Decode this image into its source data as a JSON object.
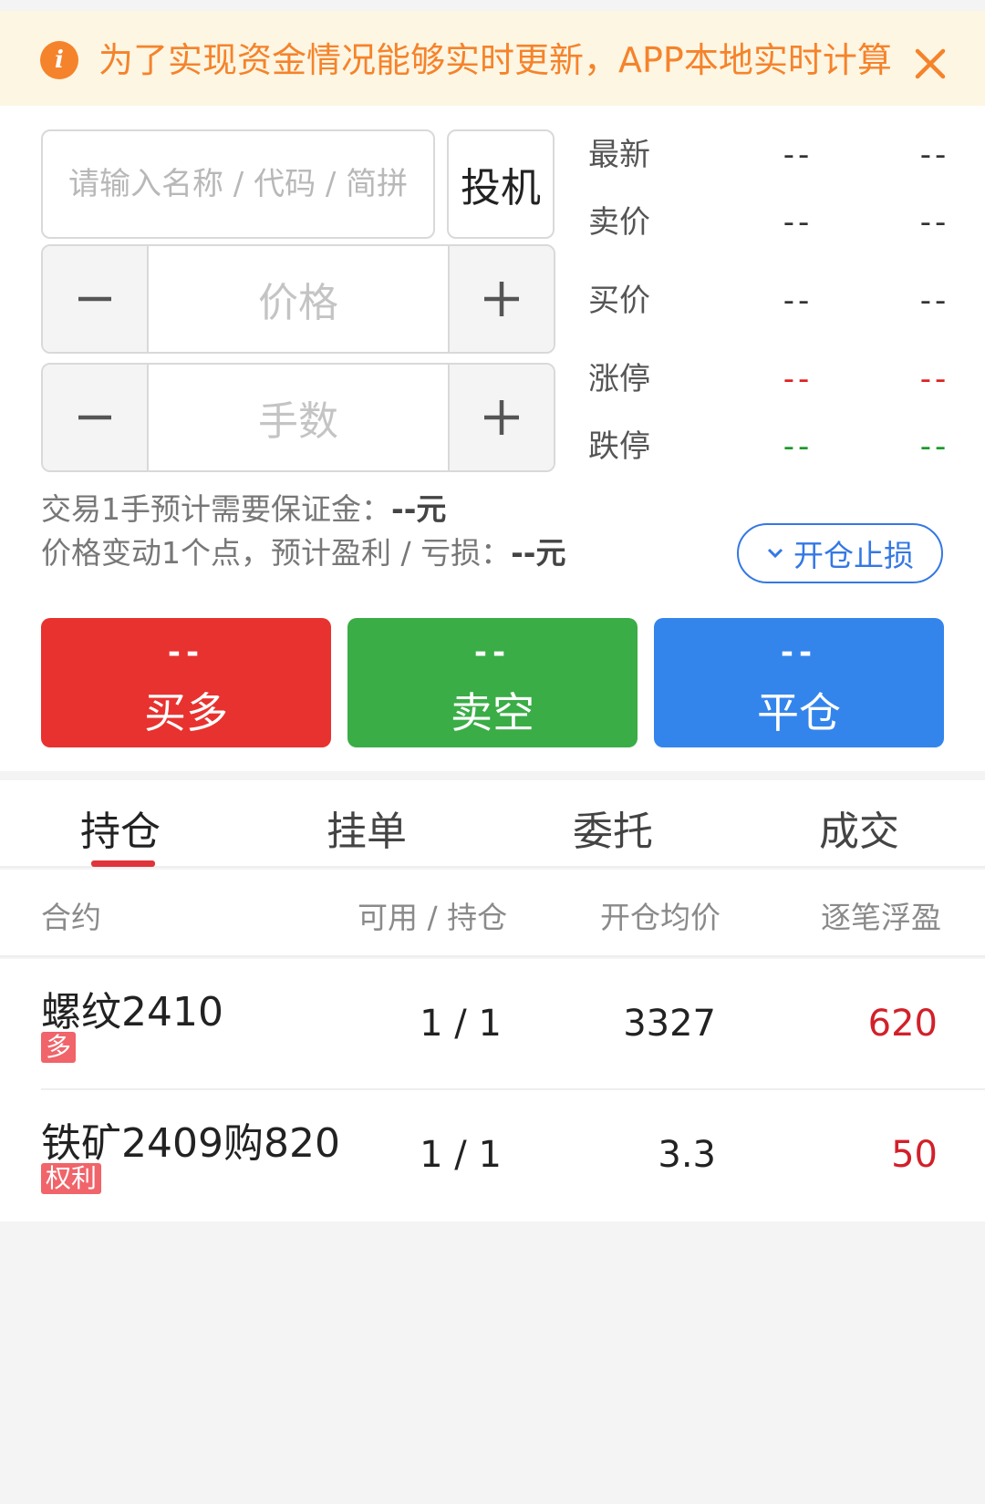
{
  "notice": {
    "text": "为了实现资金情况能够实时更新，APP本地实时计算",
    "icon": "info-icon",
    "close_icon": "close-icon",
    "accent_color": "#f5832b"
  },
  "order_form": {
    "search_placeholder": "请输入名称 / 代码 / 简拼",
    "search_value": "",
    "mode_label": "投机",
    "price_placeholder": "价格",
    "lots_placeholder": "手数"
  },
  "quotes": [
    {
      "label": "最新",
      "v1": "--",
      "v2": "--",
      "color": "default"
    },
    {
      "label": "卖价",
      "v1": "--",
      "v2": "--",
      "color": "default"
    },
    {
      "label": "买价",
      "v1": "--",
      "v2": "--",
      "color": "default"
    },
    {
      "label": "涨停",
      "v1": "--",
      "v2": "--",
      "color": "red"
    },
    {
      "label": "跌停",
      "v1": "--",
      "v2": "--",
      "color": "green"
    }
  ],
  "info": {
    "margin_prefix": "交易1手预计需要保证金：",
    "margin_value": "--元",
    "pnl_prefix": "价格变动1个点，预计盈利 / 亏损：",
    "pnl_value": "--元"
  },
  "stoploss_button": {
    "label": "开仓止损",
    "icon": "chevron-down-icon"
  },
  "actions": {
    "buy": {
      "price": "--",
      "label": "买多"
    },
    "sell": {
      "price": "--",
      "label": "卖空"
    },
    "close": {
      "price": "--",
      "label": "平仓"
    }
  },
  "tabs": [
    {
      "label": "持仓",
      "active": true
    },
    {
      "label": "挂单",
      "active": false
    },
    {
      "label": "委托",
      "active": false
    },
    {
      "label": "成交",
      "active": false
    }
  ],
  "table": {
    "headers": [
      "合约",
      "可用 / 持仓",
      "开仓均价",
      "逐笔浮盈"
    ],
    "rows": [
      {
        "name": "螺纹2410",
        "tag": "多",
        "qty": "1 / 1",
        "avg": "3327",
        "pnl": "620"
      },
      {
        "name": "铁矿2409购820",
        "tag": "权利",
        "qty": "1 / 1",
        "avg": "3.3",
        "pnl": "50"
      }
    ]
  },
  "colors": {
    "buy": "#e8322f",
    "sell": "#3aad46",
    "close": "#3385ec",
    "profit": "#d2202a"
  }
}
